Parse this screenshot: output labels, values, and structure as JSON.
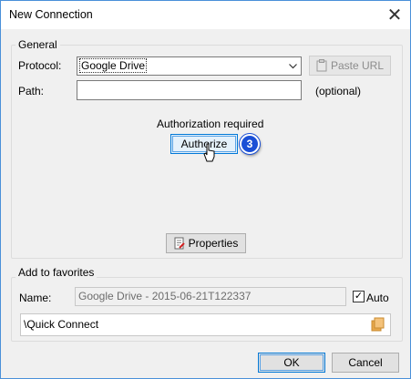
{
  "window": {
    "title": "New Connection"
  },
  "general": {
    "group_label": "General",
    "protocol_label": "Protocol:",
    "protocol_value": "Google Drive",
    "paste_url_label": "Paste URL",
    "path_label": "Path:",
    "path_value": "",
    "optional_label": "(optional)",
    "auth_required_label": "Authorization required",
    "authorize_label": "Authorize",
    "step_badge": "3",
    "properties_label": "Properties"
  },
  "favorites": {
    "group_label": "Add to favorites",
    "name_label": "Name:",
    "name_value": "Google Drive - 2015-06-21T122337",
    "auto_label": "Auto",
    "auto_checked": true,
    "folder_value": "\\Quick Connect"
  },
  "footer": {
    "ok_label": "OK",
    "cancel_label": "Cancel"
  },
  "colors": {
    "focus_border": "#0078d7",
    "badge": "#1a4fd6"
  },
  "icons": [
    "close-icon",
    "clipboard-icon",
    "chevron-down-icon",
    "properties-icon",
    "cursor-icon",
    "folder-icon",
    "checkmark-icon"
  ]
}
